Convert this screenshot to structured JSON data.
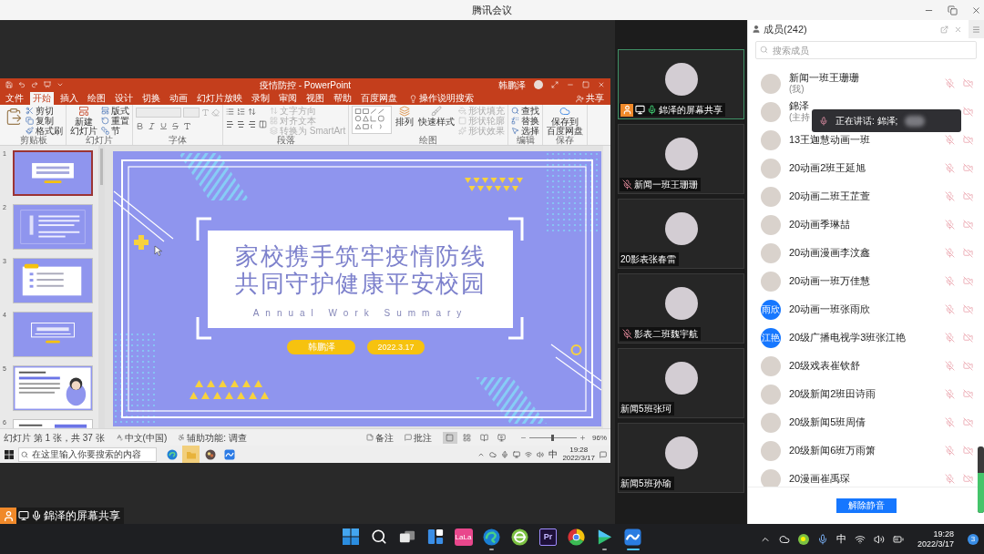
{
  "window": {
    "title": "腾讯会议"
  },
  "powerpoint": {
    "title": "疫情防控 - PowerPoint",
    "user": "韩鹏泽",
    "tabs": [
      {
        "label": "文件",
        "selected": false
      },
      {
        "label": "开始",
        "selected": true
      },
      {
        "label": "插入",
        "selected": false
      },
      {
        "label": "绘图",
        "selected": false
      },
      {
        "label": "设计",
        "selected": false
      },
      {
        "label": "切换",
        "selected": false
      },
      {
        "label": "动画",
        "selected": false
      },
      {
        "label": "幻灯片放映",
        "selected": false
      },
      {
        "label": "录制",
        "selected": false
      },
      {
        "label": "审阅",
        "selected": false
      },
      {
        "label": "视图",
        "selected": false
      },
      {
        "label": "帮助",
        "selected": false
      },
      {
        "label": "百度网盘",
        "selected": false
      }
    ],
    "tell_me": "操作说明搜索",
    "share": "共享",
    "ribbon": [
      {
        "kind": "clipboard",
        "label": "剪贴板",
        "commands": [
          {
            "label": "剪切",
            "disabled": false
          },
          {
            "label": "复制",
            "disabled": false
          },
          {
            "label": "格式刷",
            "disabled": false
          }
        ]
      },
      {
        "kind": "slides",
        "label": "幻灯片",
        "main": [
          "新建",
          "幻灯片"
        ],
        "commands": [
          {
            "label": "版式",
            "disabled": false
          },
          {
            "label": "重置",
            "disabled": false
          },
          {
            "label": "节",
            "disabled": false
          }
        ]
      },
      {
        "kind": "font",
        "label": "字体"
      },
      {
        "kind": "paragraph",
        "label": "段落",
        "commands": [
          {
            "label": "文字方向",
            "disabled": true
          },
          {
            "label": "对齐文本",
            "disabled": true
          },
          {
            "label": "转换为 SmartArt",
            "disabled": true
          }
        ]
      },
      {
        "kind": "drawing",
        "label": "绘图",
        "arrange": "排列",
        "quick_styles": "快速样式",
        "commands": [
          {
            "label": "形状填充",
            "disabled": true
          },
          {
            "label": "形状轮廓",
            "disabled": true
          },
          {
            "label": "形状效果",
            "disabled": true
          }
        ]
      },
      {
        "kind": "editing",
        "label": "编辑",
        "commands": [
          {
            "label": "查找",
            "disabled": false
          },
          {
            "label": "替换",
            "disabled": false
          },
          {
            "label": "选择",
            "disabled": false
          }
        ]
      },
      {
        "kind": "save",
        "label": "保存",
        "main": [
          "保存到",
          "百度网盘"
        ]
      }
    ],
    "slides": [
      {
        "number": "1",
        "kind": "title",
        "selected": true
      },
      {
        "number": "2",
        "kind": "text",
        "selected": false
      },
      {
        "number": "3",
        "kind": "list",
        "selected": false
      },
      {
        "number": "4",
        "kind": "section",
        "selected": false
      },
      {
        "number": "5",
        "kind": "figure",
        "selected": false
      },
      {
        "number": "6",
        "kind": "table",
        "selected": false
      }
    ],
    "slide": {
      "title_lines": [
        "家校携手筑牢疫情防线",
        "共同守护健康平安校园"
      ],
      "subtitle": "Annual Work Summary",
      "author": "韩鹏泽",
      "date": "2022.3.17"
    },
    "status_bar": {
      "slide_info": "幻灯片 第 1 张，共 37 张",
      "language": "中文(中国)",
      "accessibility": "辅助功能: 调查",
      "notes": "备注",
      "comments": "批注",
      "views": [
        {
          "kind": "normal",
          "selected": true
        },
        {
          "kind": "sorter",
          "selected": false
        },
        {
          "kind": "reading",
          "selected": false
        },
        {
          "kind": "slideshow",
          "selected": false
        }
      ],
      "zoom": {
        "level": 0.5,
        "reading": "96%"
      }
    }
  },
  "remote_taskbar": {
    "search": {
      "placeholder": "在这里输入你要搜索的内容"
    },
    "apps": [
      {
        "kind": "edge",
        "active": false
      },
      {
        "kind": "files",
        "active": true
      },
      {
        "kind": "powerpoint",
        "active": false
      },
      {
        "kind": "meeting",
        "active": false
      }
    ],
    "ime": "中",
    "time": "19:28",
    "date": "2022/3/17"
  },
  "presenter_label": "錦泽的屏幕共享",
  "video_tiles": [
    {
      "name": "錦泽的屏幕共享",
      "kind": "sharing",
      "active": true
    },
    {
      "name": "新闻一班王珊珊",
      "kind": "muted",
      "active": false
    },
    {
      "name": "20影表张春雷",
      "kind": "plain",
      "active": false
    },
    {
      "name": "影表二班魏宇航",
      "kind": "muted",
      "active": false
    },
    {
      "name": "新闻5班张珂",
      "kind": "plain",
      "active": false
    },
    {
      "name": "新闻5班孙瑜",
      "kind": "plain",
      "active": false
    }
  ],
  "members_panel": {
    "title": "成员(242)",
    "search": {
      "placeholder": "搜索成员"
    },
    "members": [
      {
        "name": "新闻一班王珊珊",
        "note": "(我)",
        "avatar": {
          "kind": "photo"
        },
        "muted": true
      },
      {
        "name": "錦泽",
        "note": "(主持",
        "avatar": {
          "kind": "photo"
        }
      },
      {
        "name": "13王迦慧动画一班",
        "avatar": {
          "kind": "photo"
        },
        "muted": true
      },
      {
        "name": "20动画2班王延旭",
        "avatar": {
          "kind": "photo"
        },
        "muted": true
      },
      {
        "name": "20动画二班王芷萱",
        "avatar": {
          "kind": "photo"
        },
        "muted": true
      },
      {
        "name": "20动画季琳喆",
        "avatar": {
          "kind": "photo"
        },
        "muted": true
      },
      {
        "name": "20动画漫画李汶鑫",
        "avatar": {
          "kind": "photo"
        },
        "muted": true
      },
      {
        "name": "20动画一班万佳慧",
        "avatar": {
          "kind": "photo"
        },
        "muted": true
      },
      {
        "name": "20动画一班张雨欣",
        "avatar": {
          "kind": "text",
          "text": "雨欣"
        },
        "muted": true
      },
      {
        "name": "20级广播电视学3班张江艳",
        "avatar": {
          "kind": "text",
          "text": "江艳"
        },
        "muted": true
      },
      {
        "name": "20级戏表崔钦舒",
        "avatar": {
          "kind": "photo"
        },
        "muted": true
      },
      {
        "name": "20级新闻2班田诗雨",
        "avatar": {
          "kind": "photo"
        },
        "muted": true
      },
      {
        "name": "20级新闻5班周倩",
        "avatar": {
          "kind": "photo"
        },
        "muted": true
      },
      {
        "name": "20级新闻6班万雨箫",
        "avatar": {
          "kind": "photo"
        },
        "muted": true
      },
      {
        "name": "20漫画崔禹琛",
        "avatar": {
          "kind": "photo"
        },
        "muted": true
      }
    ],
    "speaking_toast": "正在讲话: 錦泽;",
    "unmute_button": "解除静音",
    "mic_meter": {
      "level": 0.6
    }
  },
  "taskbar": {
    "apps": [
      {
        "kind": "start",
        "running": false,
        "focused": false
      },
      {
        "kind": "search",
        "running": false,
        "focused": false
      },
      {
        "kind": "task_view",
        "running": false,
        "focused": false
      },
      {
        "kind": "widgets",
        "running": false,
        "focused": false
      },
      {
        "kind": "lala",
        "label": "LaLa",
        "running": false,
        "focused": false
      },
      {
        "kind": "edge",
        "running": true,
        "focused": false
      },
      {
        "kind": "globe",
        "running": false,
        "focused": false
      },
      {
        "kind": "premiere",
        "label": "Pr",
        "running": false,
        "focused": false
      },
      {
        "kind": "chrome",
        "running": false,
        "focused": false
      },
      {
        "kind": "player",
        "running": true,
        "focused": false
      },
      {
        "kind": "meeting",
        "running": true,
        "focused": true
      }
    ],
    "ime": "中",
    "time": "19:28",
    "date": "2022/3/17",
    "notifications": "3"
  }
}
